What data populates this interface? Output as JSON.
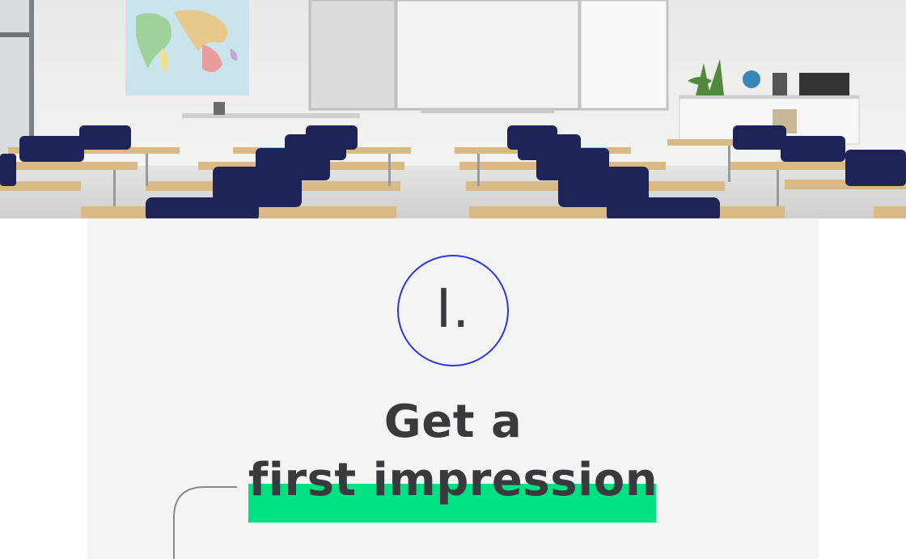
{
  "step": {
    "number": "I.",
    "accent_color": "#2b35e6"
  },
  "heading": {
    "line1": "Get a",
    "line2": "first impression",
    "highlight_color": "#00e184",
    "text_color": "#3a3a3e"
  },
  "hero": {
    "icon": "classroom-photo"
  }
}
